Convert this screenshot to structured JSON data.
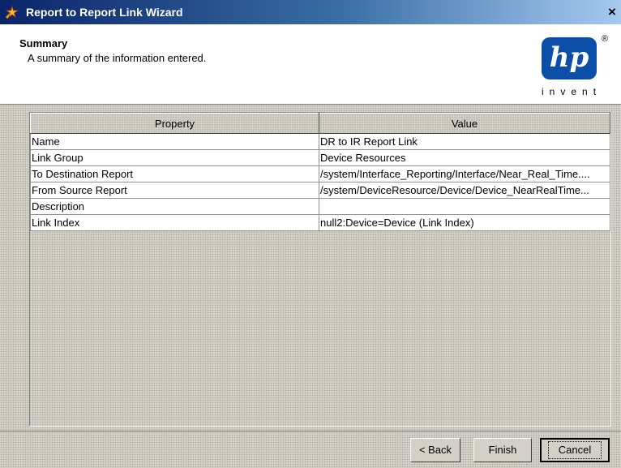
{
  "window": {
    "title": "Report to Report Link Wizard",
    "close_glyph": "×",
    "icon": "wizard-app-icon"
  },
  "header": {
    "title": "Summary",
    "subtitle": "A summary of the information entered.",
    "logo": {
      "mark": "hp",
      "registered": "®",
      "tagline": "invent",
      "brand_color": "#0a4ea8"
    }
  },
  "table": {
    "columns": [
      "Property",
      "Value"
    ],
    "rows": [
      {
        "property": "Name",
        "value": "DR to IR Report Link"
      },
      {
        "property": "Link Group",
        "value": "Device Resources"
      },
      {
        "property": "To Destination Report",
        "value": "/system/Interface_Reporting/Interface/Near_Real_Time...."
      },
      {
        "property": "From Source Report",
        "value": "/system/DeviceResource/Device/Device_NearRealTime..."
      },
      {
        "property": "Description",
        "value": ""
      },
      {
        "property": "Link Index",
        "value": "null2:Device=Device (Link Index)"
      }
    ]
  },
  "buttons": {
    "back": "< Back",
    "finish": "Finish",
    "cancel": "Cancel"
  }
}
